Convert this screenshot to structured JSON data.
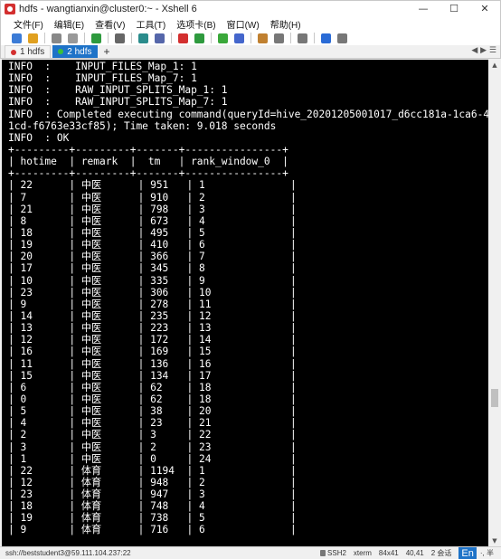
{
  "window": {
    "title": "hdfs - wangtianxin@cluster0:~ - Xshell 6",
    "buttons": {
      "minimize": "—",
      "maximize": "☐",
      "close": "✕"
    }
  },
  "menu": [
    "文件(F)",
    "编辑(E)",
    "查看(V)",
    "工具(T)",
    "选项卡(B)",
    "窗口(W)",
    "帮助(H)"
  ],
  "toolbar_icons": [
    {
      "name": "new-session-icon",
      "color": "#3b7bd6"
    },
    {
      "name": "open-folder-icon",
      "color": "#e0a020"
    },
    {
      "name": "sep"
    },
    {
      "name": "link-icon",
      "color": "#888888"
    },
    {
      "name": "copy-icon",
      "color": "#999999"
    },
    {
      "name": "sep"
    },
    {
      "name": "reconnect-icon",
      "color": "#2e9a3e"
    },
    {
      "name": "sep"
    },
    {
      "name": "find-icon",
      "color": "#666666"
    },
    {
      "name": "sep"
    },
    {
      "name": "color-scheme-icon",
      "color": "#2a8c8c"
    },
    {
      "name": "font-icon",
      "color": "#5566aa"
    },
    {
      "name": "sep"
    },
    {
      "name": "xftp-icon",
      "color": "#d32f2f"
    },
    {
      "name": "xagent-icon",
      "color": "#2e9a3e"
    },
    {
      "name": "sep"
    },
    {
      "name": "fullscreen-icon",
      "color": "#3aa83a"
    },
    {
      "name": "lock-icon",
      "color": "#4466cc"
    },
    {
      "name": "sep"
    },
    {
      "name": "script-icon",
      "color": "#c08030"
    },
    {
      "name": "keyboard-icon",
      "color": "#777777"
    },
    {
      "name": "sep"
    },
    {
      "name": "layout-icon",
      "color": "#777777"
    },
    {
      "name": "sep"
    },
    {
      "name": "help-icon",
      "color": "#2a6bd6"
    },
    {
      "name": "info-icon",
      "color": "#777777"
    }
  ],
  "tabs": [
    {
      "label": "1 hdfs",
      "active": false,
      "dot": "#d32f2f"
    },
    {
      "label": "2 hdfs",
      "active": true,
      "dot": "#3ac03a"
    }
  ],
  "terminal_lines": [
    "INFO  :    INPUT_FILES_Map_1: 1",
    "INFO  :    INPUT_FILES_Map_7: 1",
    "INFO  :    RAW_INPUT_SPLITS_Map_1: 1",
    "INFO  :    RAW_INPUT_SPLITS_Map_7: 1",
    "INFO  : Completed executing command(queryId=hive_20201205001017_d6cc181a-1ca6-4f45-9",
    "1cd-f6763e33cf85); Time taken: 9.018 seconds",
    "INFO  : OK",
    "+---------+---------+-------+----------------+",
    "| hotime  | remark  |  tm   | rank_window_0  |",
    "+---------+---------+-------+----------------+",
    "| 22      | 中医      | 951   | 1              |",
    "| 7       | 中医      | 910   | 2              |",
    "| 21      | 中医      | 798   | 3              |",
    "| 8       | 中医      | 673   | 4              |",
    "| 18      | 中医      | 495   | 5              |",
    "| 19      | 中医      | 410   | 6              |",
    "| 20      | 中医      | 366   | 7              |",
    "| 17      | 中医      | 345   | 8              |",
    "| 10      | 中医      | 335   | 9              |",
    "| 23      | 中医      | 306   | 10             |",
    "| 9       | 中医      | 278   | 11             |",
    "| 14      | 中医      | 235   | 12             |",
    "| 13      | 中医      | 223   | 13             |",
    "| 12      | 中医      | 172   | 14             |",
    "| 16      | 中医      | 169   | 15             |",
    "| 11      | 中医      | 136   | 16             |",
    "| 15      | 中医      | 134   | 17             |",
    "| 6       | 中医      | 62    | 18             |",
    "| 0       | 中医      | 62    | 18             |",
    "| 5       | 中医      | 38    | 20             |",
    "| 4       | 中医      | 23    | 21             |",
    "| 2       | 中医      | 3     | 22             |",
    "| 3       | 中医      | 2     | 23             |",
    "| 1       | 中医      | 0     | 24             |",
    "| 22      | 体育      | 1194  | 1              |",
    "| 12      | 体育      | 948   | 2              |",
    "| 23      | 体育      | 947   | 3              |",
    "| 18      | 体育      | 748   | 4              |",
    "| 19      | 体育      | 738   | 5              |",
    "| 9       | 体育      | 716   | 6              |"
  ],
  "statusbar": {
    "connection": "ssh://beststudent3@59.111.104.237:22",
    "protocol": "SSH2",
    "term": "xterm",
    "size": "84x41",
    "cursor": "40,41",
    "sessions": "2 会话",
    "ime": "En",
    "ime_extra": "·, 半"
  }
}
